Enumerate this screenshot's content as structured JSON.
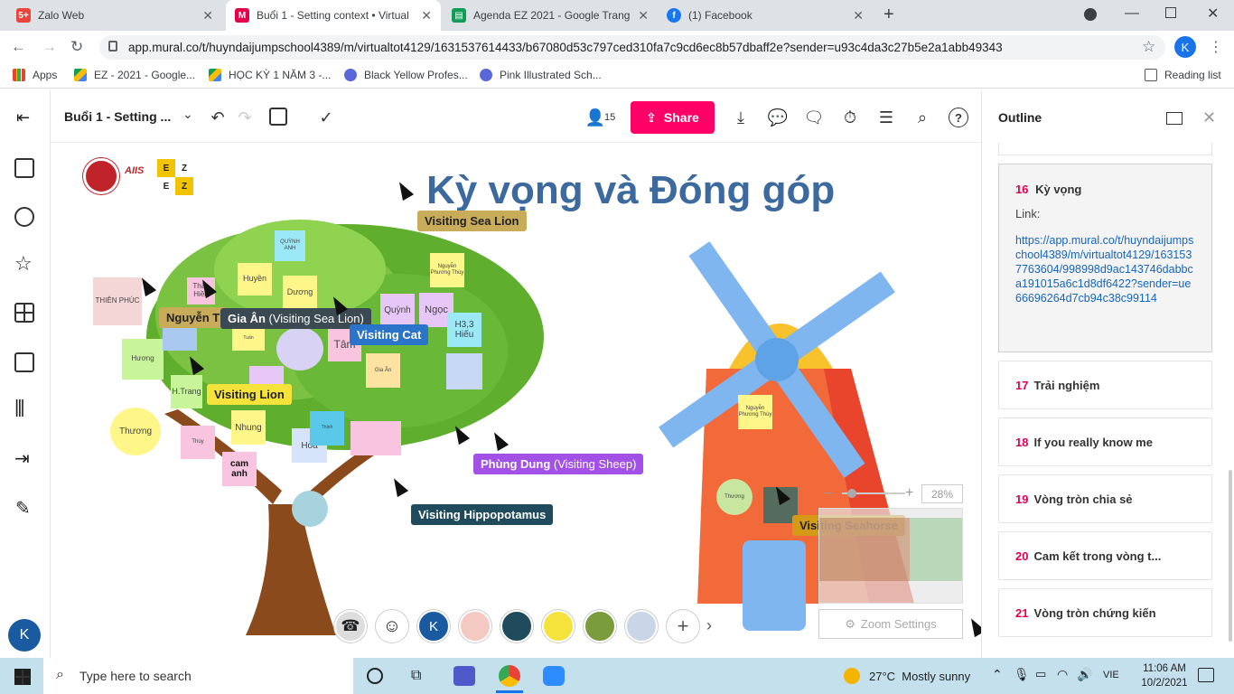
{
  "browser": {
    "tabs": [
      {
        "title": "Zalo Web",
        "icon": "zalo-icon",
        "color": "#e8453c"
      },
      {
        "title": "Buổi 1 - Setting context • Virtual",
        "icon": "mural-icon",
        "color": "#e6004c"
      },
      {
        "title": "Agenda EZ 2021 - Google Trang",
        "icon": "google-sheets-icon",
        "color": "#0f9d58"
      },
      {
        "title": "(1) Facebook",
        "icon": "facebook-icon",
        "color": "#1877f2"
      }
    ],
    "url": "app.mural.co/t/huyndaijumpschool4389/m/virtualtot4129/1631537614433/b67080d53c797ced310fa7c9cd6ec8b57dbaff2e?sender=u93c4da3c27b5e2a1abb49343",
    "profile_initial": "K",
    "bookmarks": [
      {
        "label": "Apps",
        "icon": "apps-grid-icon"
      },
      {
        "label": "EZ - 2021 - Google...",
        "icon": "google-drive-icon"
      },
      {
        "label": "HỌC KỲ 1 NĂM 3 -...",
        "icon": "google-drive-icon"
      },
      {
        "label": "Black Yellow Profes...",
        "icon": "canva-icon"
      },
      {
        "label": "Pink Illustrated Sch...",
        "icon": "canva-icon"
      }
    ],
    "reading_list": "Reading list"
  },
  "mural": {
    "board_title": "Buổi 1 - Setting ...",
    "collaborator_count": "15",
    "share_label": "Share",
    "canvas_title": "Kỳ vọng và Đóng góp",
    "logo_letters": [
      "E",
      "Z",
      "E",
      "Z"
    ],
    "logo_text": "AIIS",
    "zoom_percent": "28%",
    "zoom_settings": "Zoom Settings",
    "user_initial": "K"
  },
  "stickies": [
    {
      "text": "THIÊN PHÚC",
      "color": "#f4d6d6"
    },
    {
      "text": "Huyền",
      "color": "#fff68a"
    },
    {
      "text": "Dương",
      "color": "#fff68a"
    },
    {
      "text": "QUỲNH ANH",
      "color": "#9be8f7"
    },
    {
      "text": "Thảo Hiền",
      "color": "#f9c4e0"
    },
    {
      "text": "Quỳnh",
      "color": "#e6c7f7"
    },
    {
      "text": "Ngọc",
      "color": "#e6c7f7"
    },
    {
      "text": "Nguyễn Phương Thùy",
      "color": "#fff68a"
    },
    {
      "text": "H3,3 Hiếu",
      "color": "#9be8f7"
    },
    {
      "text": "Tâm",
      "color": "#f9c4e0"
    },
    {
      "text": "Hương",
      "color": "#c9f59a"
    },
    {
      "text": "Gia Ân",
      "color": "#fde3a1"
    },
    {
      "text": "H.Trang",
      "color": "#c9f59a"
    },
    {
      "text": "Nhung",
      "color": "#fff68a"
    },
    {
      "text": "Thương",
      "color": "#fff68a"
    },
    {
      "text": "Thùy",
      "color": "#f9c4e0"
    },
    {
      "text": "cam anh",
      "color": "#f9c4e0"
    },
    {
      "text": "Hòa",
      "color": "#d6e4fb"
    },
    {
      "text": "Tuấn",
      "color": "#fff68a"
    },
    {
      "text": "Thịnh",
      "color": "#9be8f7"
    },
    {
      "text": "Nguyễn Phương Thùy",
      "color": "#fff68a"
    },
    {
      "text": "Thương",
      "color": "#c9f59a"
    }
  ],
  "tags": [
    {
      "text": "Visiting Sea Lion",
      "bg": "#c9ac5a",
      "fg": "#222"
    },
    {
      "text": "Nguyễn T",
      "bg": "#c9ac5a",
      "fg": "#222"
    },
    {
      "text": "Gia Ân",
      "sub": "(Visiting Sea Lion)",
      "bg": "#3b4a52",
      "fg": "#fff"
    },
    {
      "text": "Visiting Cat",
      "bg": "#2a74c9",
      "fg": "#fff"
    },
    {
      "text": "Visiting Lion",
      "bg": "#f5e23b",
      "fg": "#222"
    },
    {
      "text": "Phùng Dung",
      "sub": "(Visiting Sheep)",
      "bg": "#a250e6",
      "fg": "#fff"
    },
    {
      "text": "Visiting Hippopotamus",
      "bg": "#1f4b5c",
      "fg": "#fff"
    },
    {
      "text": "Visiting Seahorse",
      "bg": "#d49a17",
      "fg": "#222"
    }
  ],
  "outline": {
    "title": "Outline",
    "current": {
      "number": "16",
      "title": "Kỳ vọng",
      "link_label": "Link:",
      "link": "https://app.mural.co/t/huyndaijumpschool4389/m/virtualtot4129/1631537763604/998998d9ac143746dabbca191015a6c1d8df6422?sender=ue66696264d7cb94c38c99114"
    },
    "items": [
      {
        "number": "17",
        "title": "Trải nghiệm"
      },
      {
        "number": "18",
        "title": "If you really know me"
      },
      {
        "number": "19",
        "title": "Vòng tròn chia sẻ"
      },
      {
        "number": "20",
        "title": "Cam kết trong vòng t..."
      },
      {
        "number": "21",
        "title": "Vòng tròn chứng kiến"
      }
    ]
  },
  "taskbar": {
    "search_placeholder": "Type here to search",
    "weather": "27°C  Mostly sunny",
    "lang": "VIE",
    "time": "11:06 AM",
    "date": "10/2/2021"
  }
}
